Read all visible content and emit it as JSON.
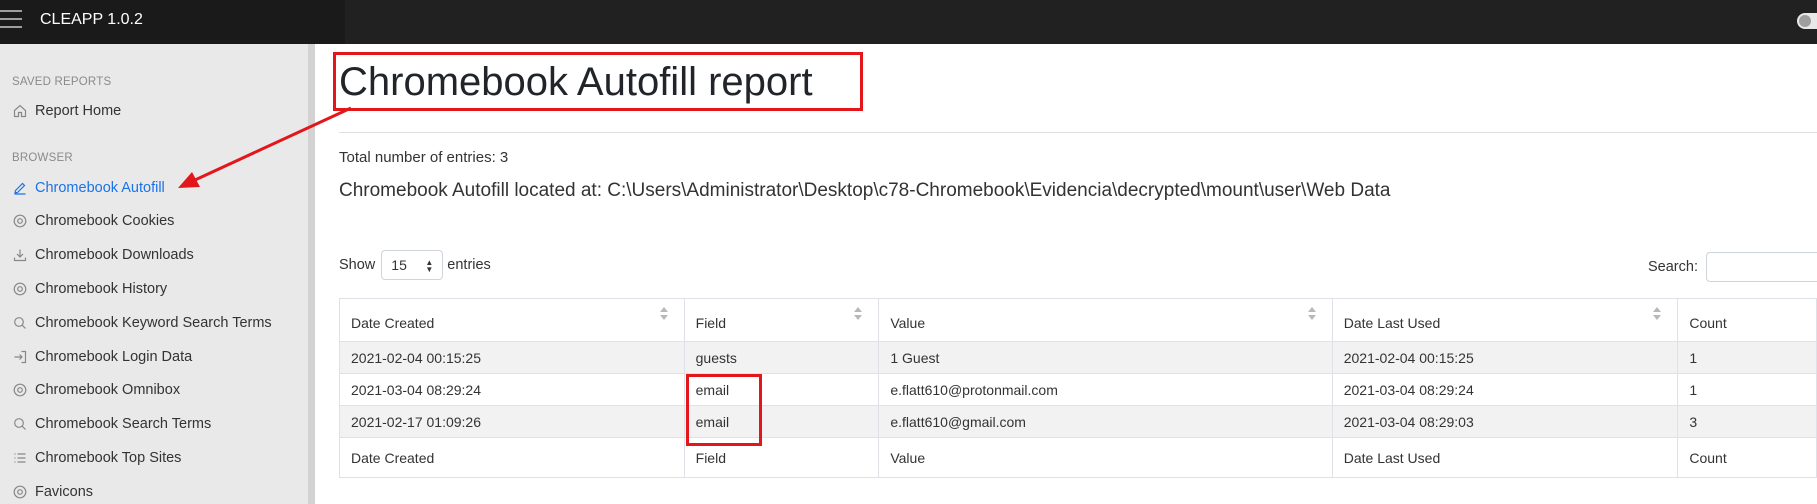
{
  "app": {
    "title": "CLEAPP 1.0.2"
  },
  "sidebar": {
    "sections": [
      {
        "heading": "SAVED REPORTS",
        "items": [
          {
            "label": "Report Home",
            "icon": "home-icon"
          }
        ]
      },
      {
        "heading": "BROWSER",
        "items": [
          {
            "label": "Chromebook Autofill",
            "icon": "edit-icon",
            "active": true
          },
          {
            "label": "Chromebook Cookies",
            "icon": "chrome-icon"
          },
          {
            "label": "Chromebook Downloads",
            "icon": "download-icon"
          },
          {
            "label": "Chromebook History",
            "icon": "chrome-icon"
          },
          {
            "label": "Chromebook Keyword Search Terms",
            "icon": "search-icon"
          },
          {
            "label": "Chromebook Login Data",
            "icon": "login-icon"
          },
          {
            "label": "Chromebook Omnibox",
            "icon": "chrome-icon"
          },
          {
            "label": "Chromebook Search Terms",
            "icon": "search-icon"
          },
          {
            "label": "Chromebook Top Sites",
            "icon": "list-icon"
          },
          {
            "label": "Favicons",
            "icon": "chrome-icon"
          }
        ]
      }
    ]
  },
  "main": {
    "title": "Chromebook Autofill report",
    "total": "Total number of entries: 3",
    "location": "Chromebook Autofill located at: C:\\Users\\Administrator\\Desktop\\c78-Chromebook\\Evidencia\\decrypted\\mount\\user\\Web Data",
    "show_label": "Show",
    "show_value": "15",
    "entries_label": "entries",
    "search_label": "Search:"
  },
  "table": {
    "columns": [
      "Date Created",
      "Field",
      "Value",
      "Date Last Used",
      "Count"
    ],
    "rows": [
      [
        "2021-02-04 00:15:25",
        "guests",
        "1 Guest",
        "2021-02-04 00:15:25",
        "1"
      ],
      [
        "2021-03-04 08:29:24",
        "email",
        "e.flatt610@protonmail.com",
        "2021-03-04 08:29:24",
        "1"
      ],
      [
        "2021-02-17 01:09:26",
        "email",
        "e.flatt610@gmail.com",
        "2021-03-04 08:29:03",
        "3"
      ]
    ]
  },
  "colors": {
    "accent": "#1a73e8",
    "annotation": "#e3161b",
    "topbar": "#212121"
  }
}
